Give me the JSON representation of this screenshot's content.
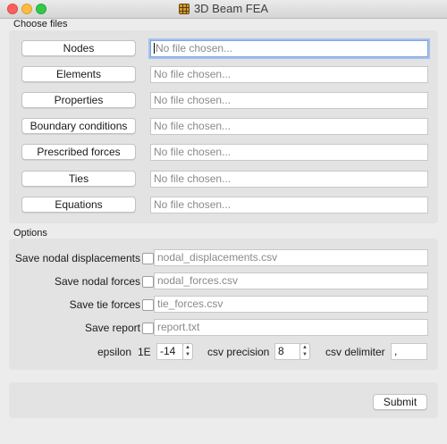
{
  "window": {
    "title": "3D Beam FEA",
    "icon": "grid-app-icon"
  },
  "choose_files": {
    "heading": "Choose files",
    "rows": [
      {
        "button": "Nodes",
        "placeholder": "No file chosen..."
      },
      {
        "button": "Elements",
        "placeholder": "No file chosen..."
      },
      {
        "button": "Properties",
        "placeholder": "No file chosen..."
      },
      {
        "button": "Boundary conditions",
        "placeholder": "No file chosen..."
      },
      {
        "button": "Prescribed forces",
        "placeholder": "No file chosen..."
      },
      {
        "button": "Ties",
        "placeholder": "No file chosen..."
      },
      {
        "button": "Equations",
        "placeholder": "No file chosen..."
      }
    ]
  },
  "options": {
    "heading": "Options",
    "rows": [
      {
        "label": "Save nodal displacements",
        "checked": false,
        "placeholder": "nodal_displacements.csv"
      },
      {
        "label": "Save nodal forces",
        "checked": false,
        "placeholder": "nodal_forces.csv"
      },
      {
        "label": "Save tie forces",
        "checked": false,
        "placeholder": "tie_forces.csv"
      },
      {
        "label": "Save report",
        "checked": false,
        "placeholder": "report.txt"
      }
    ],
    "epsilon_label": "epsilon",
    "epsilon_prefix": "1E",
    "epsilon_value": "-14",
    "csv_precision_label": "csv precision",
    "csv_precision_value": "8",
    "csv_delimiter_label": "csv delimiter",
    "csv_delimiter_value": ","
  },
  "actions": {
    "submit": "Submit"
  },
  "colors": {
    "focus_ring": "#7aa7e6",
    "close": "#fc605c",
    "minimize": "#fdbc40",
    "maximize": "#34c84a"
  }
}
